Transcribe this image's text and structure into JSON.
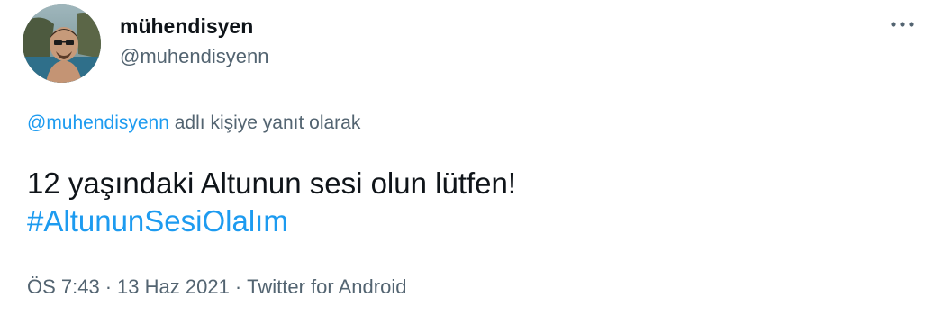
{
  "author": {
    "display_name": "mühendisyen",
    "handle": "@muhendisyenn"
  },
  "reply_context": {
    "mention": "@muhendisyenn",
    "suffix": " adlı kişiye yanıt olarak"
  },
  "tweet": {
    "text": "12 yaşındaki Altunun sesi olun lütfen!",
    "hashtag": "#AltununSesiOlalım"
  },
  "meta": {
    "time": "ÖS 7:43",
    "separator": "·",
    "date": "13 Haz 2021",
    "source": "Twitter for Android"
  },
  "icons": {
    "more": "more-horizontal-icon",
    "avatar": "avatar"
  },
  "colors": {
    "link": "#1d9bf0",
    "text": "#0f1419",
    "secondary": "#536471"
  }
}
